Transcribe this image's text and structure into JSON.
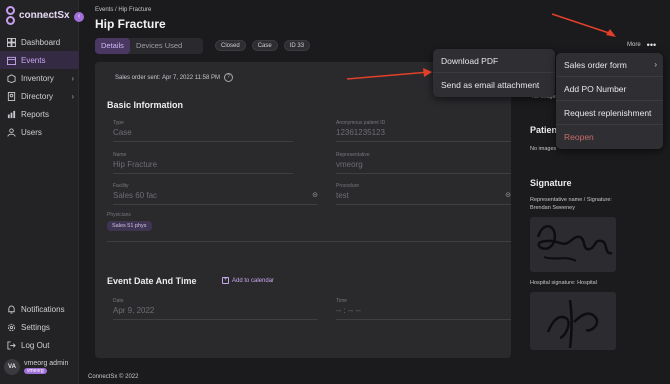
{
  "brand": {
    "name": "connectSx",
    "sub": "MED DEVICE"
  },
  "sidebar": {
    "items": [
      {
        "label": "Dashboard",
        "icon": "dashboard-icon"
      },
      {
        "label": "Events",
        "icon": "calendar-icon"
      },
      {
        "label": "Inventory",
        "icon": "box-icon"
      },
      {
        "label": "Directory",
        "icon": "contacts-icon"
      },
      {
        "label": "Reports",
        "icon": "chart-icon"
      },
      {
        "label": "Users",
        "icon": "users-icon"
      }
    ],
    "bottom": [
      {
        "label": "Notifications",
        "icon": "bell-icon"
      },
      {
        "label": "Settings",
        "icon": "gear-icon"
      },
      {
        "label": "Log Out",
        "icon": "logout-icon"
      }
    ],
    "user": {
      "initials": "VA",
      "name": "vmeorg admin",
      "badge": "vmeorg"
    }
  },
  "header": {
    "breadcrumb": "Events / Hip Fracture",
    "title": "Hip Fracture",
    "tabs": [
      "Details",
      "Devices Used"
    ],
    "chips": [
      "Closed",
      "Case",
      "ID 33"
    ],
    "more_label": "More"
  },
  "details": {
    "sent_label": "Sales order sent:",
    "sent_value": "Apr 7, 2022 11:58 PM",
    "basic_title": "Basic Information",
    "fields": {
      "type": {
        "label": "Type",
        "value": "Case"
      },
      "patient": {
        "label": "Anonymous patient ID",
        "value": "12361235123"
      },
      "name": {
        "label": "Name",
        "value": "Hip Fracture"
      },
      "rep": {
        "label": "Representative",
        "value": "vmeorg"
      },
      "facility": {
        "label": "Facility",
        "value": "Sales 60 fac"
      },
      "procedure": {
        "label": "Procedure",
        "value": "test"
      },
      "physician": {
        "label": "Physicians",
        "value": "Sales 51 phys"
      }
    },
    "event_title": "Event Date And Time",
    "add_calendar": "Add to calendar",
    "date": {
      "label": "Date",
      "value": "Apr 9, 2022"
    },
    "time": {
      "label": "Time",
      "value": "-- : -- --"
    }
  },
  "right": {
    "images_top": "No images",
    "patient_title": "Patien",
    "images": "No images",
    "signature_title": "Signature",
    "rep_sig": "Representative name / Signature:",
    "rep_name": "Brendan Sweeney",
    "hospital_sig": "Hospital signature: Hospital"
  },
  "pdf_menu": [
    "Download PDF",
    "Send as email attachment"
  ],
  "more_menu": [
    "Sales order form",
    "Add PO Number",
    "Request replenishment",
    "Reopen"
  ],
  "footer": "ConnectSx © 2022",
  "colors": {
    "accent": "#a06fd8",
    "danger": "#c96b6b",
    "arrow": "#e0402a"
  }
}
